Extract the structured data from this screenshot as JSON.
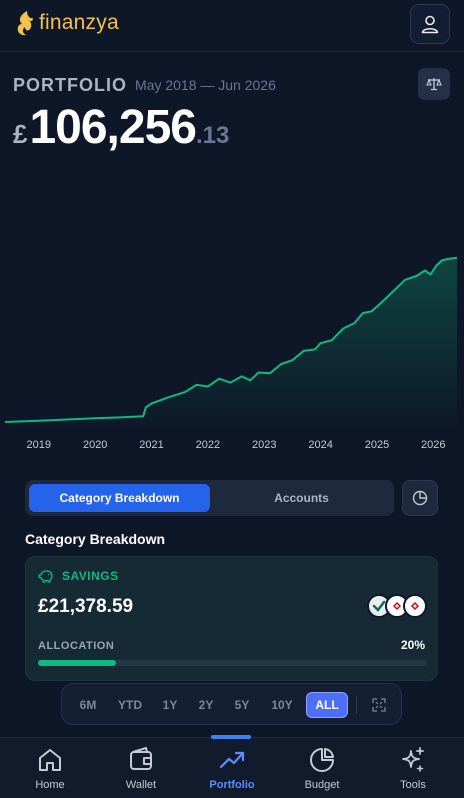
{
  "app": {
    "name": "finanzya"
  },
  "portfolio": {
    "label": "PORTFOLIO",
    "date_range": "May 2018 — Jun 2026",
    "currency_symbol": "£",
    "total_integer": "106,256",
    "total_decimal": ".13"
  },
  "chart_data": {
    "type": "area",
    "x_tick_labels": [
      "2019",
      "2020",
      "2021",
      "2022",
      "2023",
      "2024",
      "2025",
      "2026"
    ],
    "x": [
      2018.4,
      2019.0,
      2019.5,
      2020.0,
      2020.5,
      2020.85,
      2020.9,
      2021.0,
      2021.3,
      2021.6,
      2021.8,
      2022.0,
      2022.2,
      2022.4,
      2022.6,
      2022.75,
      2022.9,
      2023.1,
      2023.3,
      2023.5,
      2023.7,
      2023.9,
      2024.0,
      2024.2,
      2024.4,
      2024.6,
      2024.75,
      2024.9,
      2025.1,
      2025.3,
      2025.5,
      2025.7,
      2025.85,
      2025.95,
      2026.05,
      2026.15,
      2026.25,
      2026.42
    ],
    "values": [
      0,
      800,
      1600,
      2400,
      3100,
      3700,
      9500,
      12000,
      16000,
      19500,
      24000,
      23000,
      28000,
      25500,
      29500,
      27000,
      32000,
      31500,
      37500,
      40000,
      46000,
      47000,
      51000,
      53000,
      60500,
      64000,
      70500,
      71500,
      78000,
      85000,
      92000,
      94500,
      98000,
      95500,
      101000,
      104500,
      105500,
      106256
    ],
    "title": "",
    "xlabel": "",
    "ylabel": "",
    "ylim": [
      0,
      110000
    ],
    "grid": false,
    "line_color": "#10b981"
  },
  "tabs": {
    "category_breakdown": "Category Breakdown",
    "accounts": "Accounts"
  },
  "section": {
    "title": "Category Breakdown"
  },
  "savings_card": {
    "label": "SAVINGS",
    "amount": "£21,378.59",
    "allocation_label": "ALLOCATION",
    "allocation_pct": "20%",
    "allocation_fraction": 0.2,
    "accent_color": "#10b981"
  },
  "ranges": [
    "6M",
    "YTD",
    "1Y",
    "2Y",
    "5Y",
    "10Y",
    "ALL"
  ],
  "active_range": "ALL",
  "nav": [
    {
      "label": "Home",
      "icon": "home-icon"
    },
    {
      "label": "Wallet",
      "icon": "wallet-icon"
    },
    {
      "label": "Portfolio",
      "icon": "trending-up-icon"
    },
    {
      "label": "Budget",
      "icon": "pie-chart-icon"
    },
    {
      "label": "Tools",
      "icon": "sparkles-icon"
    }
  ],
  "colors": {
    "accent_blue": "#2563eb",
    "positive": "#10b981",
    "brand": "#f2c14e",
    "background": "#0e1728"
  }
}
